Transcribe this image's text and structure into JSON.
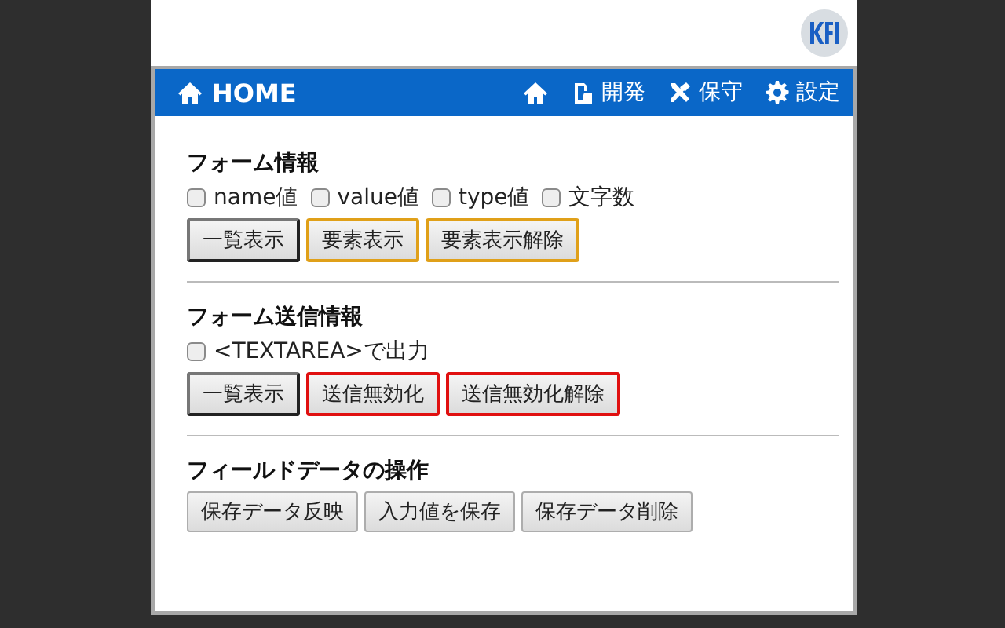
{
  "header": {
    "title": "HOME",
    "nav": [
      {
        "kind": "home"
      },
      {
        "kind": "dev",
        "label": "開発"
      },
      {
        "kind": "tools",
        "label": "保守"
      },
      {
        "kind": "gear",
        "label": "設定"
      }
    ]
  },
  "sections": [
    {
      "title": "フォーム情報",
      "checkboxes": [
        {
          "label": "name値",
          "checked": false
        },
        {
          "label": "value値",
          "checked": false
        },
        {
          "label": "type値",
          "checked": false
        },
        {
          "label": "文字数",
          "checked": false
        }
      ],
      "buttons": [
        {
          "label": "一覧表示",
          "kind": "dark"
        },
        {
          "label": "要素表示",
          "kind": "orange"
        },
        {
          "label": "要素表示解除",
          "kind": "orange"
        }
      ]
    },
    {
      "title": "フォーム送信情報",
      "checkboxes": [
        {
          "label": "<TEXTAREA>で出力",
          "checked": false
        }
      ],
      "buttons": [
        {
          "label": "一覧表示",
          "kind": "dark"
        },
        {
          "label": "送信無効化",
          "kind": "red"
        },
        {
          "label": "送信無効化解除",
          "kind": "red"
        }
      ]
    },
    {
      "title": "フィールドデータの操作",
      "buttons": [
        {
          "label": "保存データ反映",
          "kind": "plain"
        },
        {
          "label": "入力値を保存",
          "kind": "plain"
        },
        {
          "label": "保存データ削除",
          "kind": "plain"
        }
      ]
    }
  ]
}
